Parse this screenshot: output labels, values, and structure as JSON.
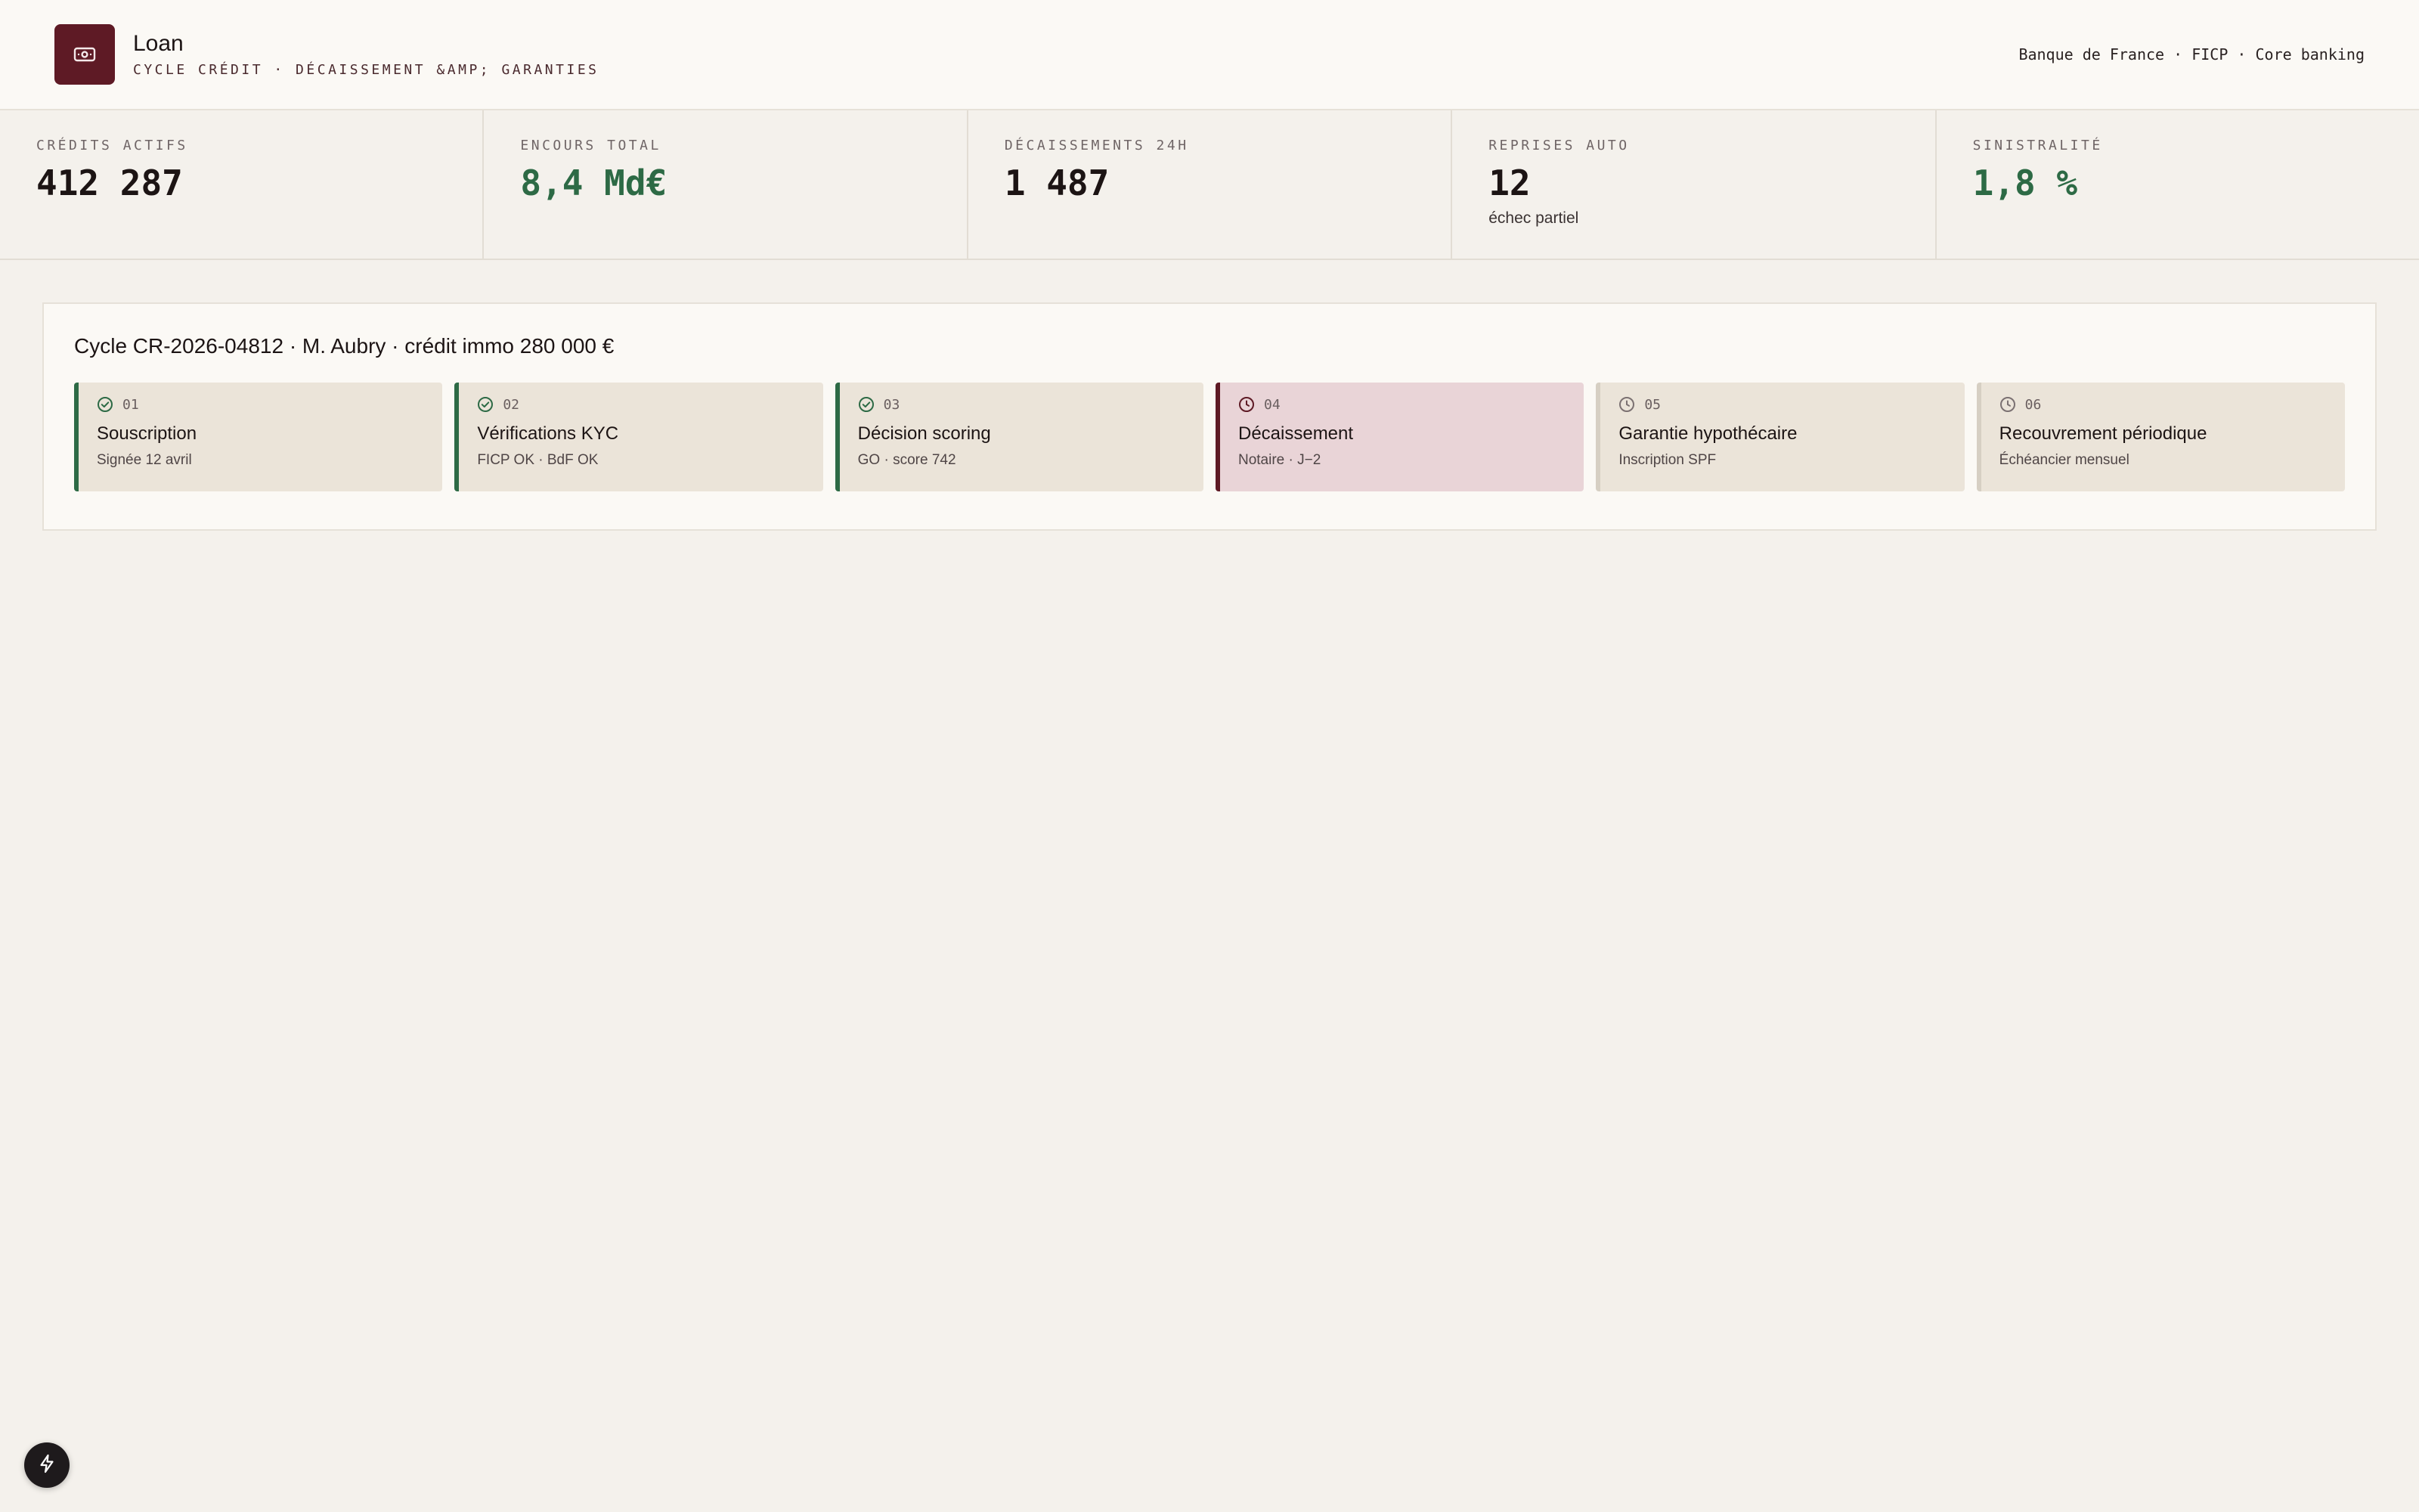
{
  "header": {
    "app_name": "Loan",
    "subtitle": "CYCLE CRÉDIT · DÉCAISSEMENT &AMP; GARANTIES",
    "meta": "Banque de France · FICP · Core banking",
    "logo_icon": "banknote-icon"
  },
  "kpis": [
    {
      "label": "CRÉDITS ACTIFS",
      "value": "412 287",
      "note": ""
    },
    {
      "label": "ENCOURS TOTAL",
      "value": "8,4 Md€",
      "note": ""
    },
    {
      "label": "DÉCAISSEMENTS 24H",
      "value": "1 487",
      "note": ""
    },
    {
      "label": "REPRISES AUTO",
      "value": "12",
      "note": "échec partiel"
    },
    {
      "label": "SINISTRALITÉ",
      "value": "1,8 %",
      "note": ""
    }
  ],
  "cycle": {
    "title": "Cycle CR-2026-04812 · M. Aubry · crédit immo 280 000 €",
    "steps": [
      {
        "num": "01",
        "title": "Souscription",
        "sub": "Signée 12 avril",
        "status": "done",
        "icon": "check-circle-icon"
      },
      {
        "num": "02",
        "title": "Vérifications KYC",
        "sub": "FICP OK · BdF OK",
        "status": "done",
        "icon": "check-circle-icon"
      },
      {
        "num": "03",
        "title": "Décision scoring",
        "sub": "GO · score 742",
        "status": "done",
        "icon": "check-circle-icon"
      },
      {
        "num": "04",
        "title": "Décaissement",
        "sub": "Notaire · J−2",
        "status": "current",
        "icon": "clock-icon"
      },
      {
        "num": "05",
        "title": "Garantie hypothécaire",
        "sub": "Inscription SPF",
        "status": "pending",
        "icon": "clock-icon"
      },
      {
        "num": "06",
        "title": "Recouvrement périodique",
        "sub": "Échéancier mensuel",
        "status": "pending",
        "icon": "clock-icon"
      }
    ]
  },
  "colors": {
    "brand": "#5e1a25",
    "positive": "#2d6a45",
    "background": "#f4f1ec",
    "surface": "#fbf9f5",
    "step_bg": "#ebe4d9",
    "step_current_bg": "#e9d4d7"
  },
  "fab": {
    "icon": "bolt-icon"
  }
}
